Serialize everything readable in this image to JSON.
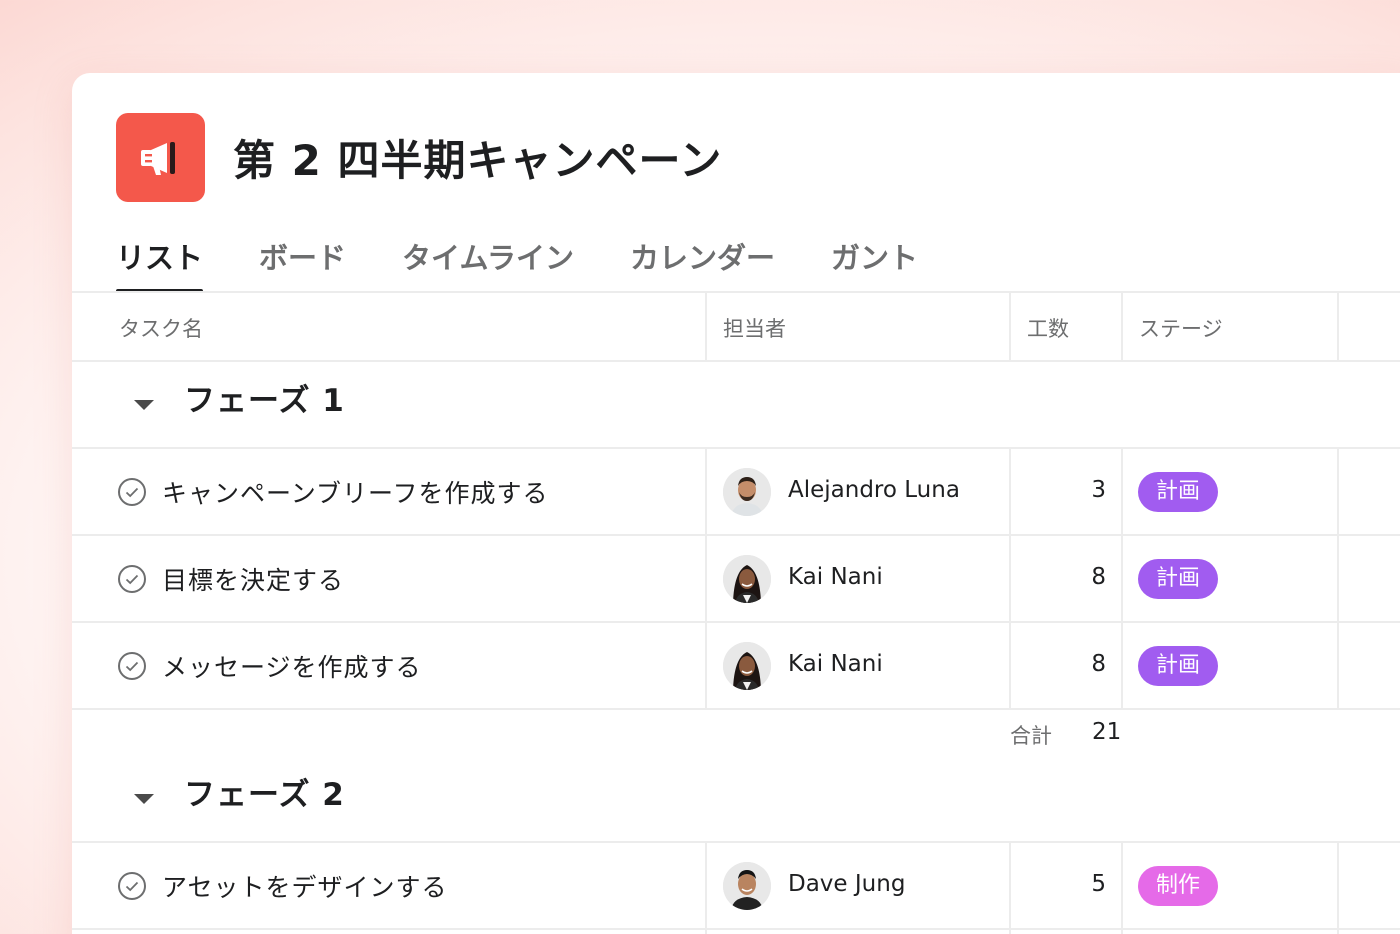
{
  "project": {
    "icon": "megaphone-icon",
    "icon_color": "#f4584b",
    "title": "第 2 四半期キャンペーン"
  },
  "tabs": [
    {
      "label": "リスト",
      "active": true
    },
    {
      "label": "ボード",
      "active": false
    },
    {
      "label": "タイムライン",
      "active": false
    },
    {
      "label": "カレンダー",
      "active": false
    },
    {
      "label": "ガント",
      "active": false
    }
  ],
  "columns": {
    "task": "タスク名",
    "assignee": "担当者",
    "effort": "工数",
    "stage": "ステージ"
  },
  "sections": [
    {
      "title": "フェーズ 1",
      "tasks": [
        {
          "name": "キャンペーンブリーフを作成する",
          "assignee": "Alejandro Luna",
          "effort": "3",
          "stage": "計画",
          "stage_color": "#a15cf0"
        },
        {
          "name": "目標を決定する",
          "assignee": "Kai Nani",
          "effort": "8",
          "stage": "計画",
          "stage_color": "#a15cf0"
        },
        {
          "name": "メッセージを作成する",
          "assignee": "Kai Nani",
          "effort": "8",
          "stage": "計画",
          "stage_color": "#a15cf0"
        }
      ],
      "total_label": "合計",
      "total_value": "21"
    },
    {
      "title": "フェーズ 2",
      "tasks": [
        {
          "name": "アセットをデザインする",
          "assignee": "Dave Jung",
          "effort": "5",
          "stage": "制作",
          "stage_color": "#e56ae8"
        }
      ]
    }
  ]
}
